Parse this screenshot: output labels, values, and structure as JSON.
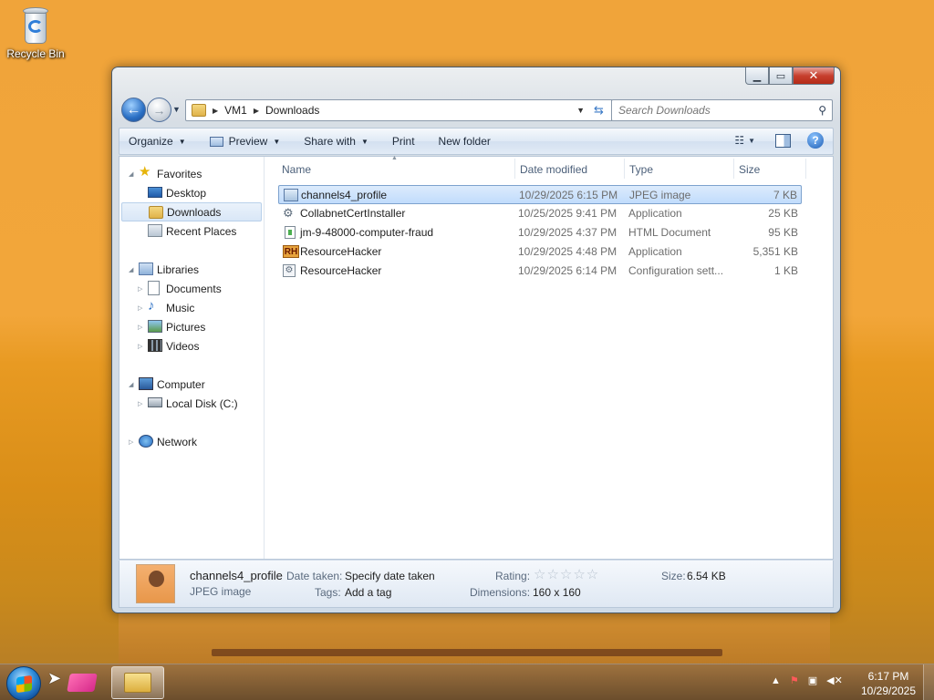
{
  "desktop": {
    "recycle_bin_label": "Recycle Bin"
  },
  "window": {
    "address": {
      "crumbs": [
        "VM1",
        "Downloads"
      ]
    },
    "search": {
      "placeholder": "Search Downloads"
    },
    "toolbar": {
      "organize": "Organize",
      "preview": "Preview",
      "share_with": "Share with",
      "print": "Print",
      "new_folder": "New folder"
    },
    "nav": {
      "favorites": "Favorites",
      "desktop": "Desktop",
      "downloads": "Downloads",
      "recent_places": "Recent Places",
      "libraries": "Libraries",
      "documents": "Documents",
      "music": "Music",
      "pictures": "Pictures",
      "videos": "Videos",
      "computer": "Computer",
      "local_disk": "Local Disk (C:)",
      "network": "Network"
    },
    "columns": {
      "name": "Name",
      "date_modified": "Date modified",
      "type": "Type",
      "size": "Size"
    },
    "files": [
      {
        "name": "channels4_profile",
        "date": "10/29/2025 6:15 PM",
        "type": "JPEG image",
        "size": "7 KB"
      },
      {
        "name": "CollabnetCertInstaller",
        "date": "10/25/2025 9:41 PM",
        "type": "Application",
        "size": "25 KB"
      },
      {
        "name": "jm-9-48000-computer-fraud",
        "date": "10/29/2025 4:37 PM",
        "type": "HTML Document",
        "size": "95 KB"
      },
      {
        "name": "ResourceHacker",
        "date": "10/29/2025 4:48 PM",
        "type": "Application",
        "size": "5,351 KB"
      },
      {
        "name": "ResourceHacker",
        "date": "10/29/2025 6:14 PM",
        "type": "Configuration sett...",
        "size": "1 KB"
      }
    ],
    "details": {
      "filename": "channels4_profile",
      "filetype": "JPEG image",
      "date_taken_label": "Date taken:",
      "date_taken_value": "Specify date taken",
      "tags_label": "Tags:",
      "tags_value": "Add a tag",
      "rating_label": "Rating:",
      "rating_stars": "☆☆☆☆☆",
      "dimensions_label": "Dimensions:",
      "dimensions_value": "160 x 160",
      "size_label": "Size:",
      "size_value": "6.54 KB"
    }
  },
  "taskbar": {
    "time": "6:17 PM",
    "date": "10/29/2025"
  }
}
